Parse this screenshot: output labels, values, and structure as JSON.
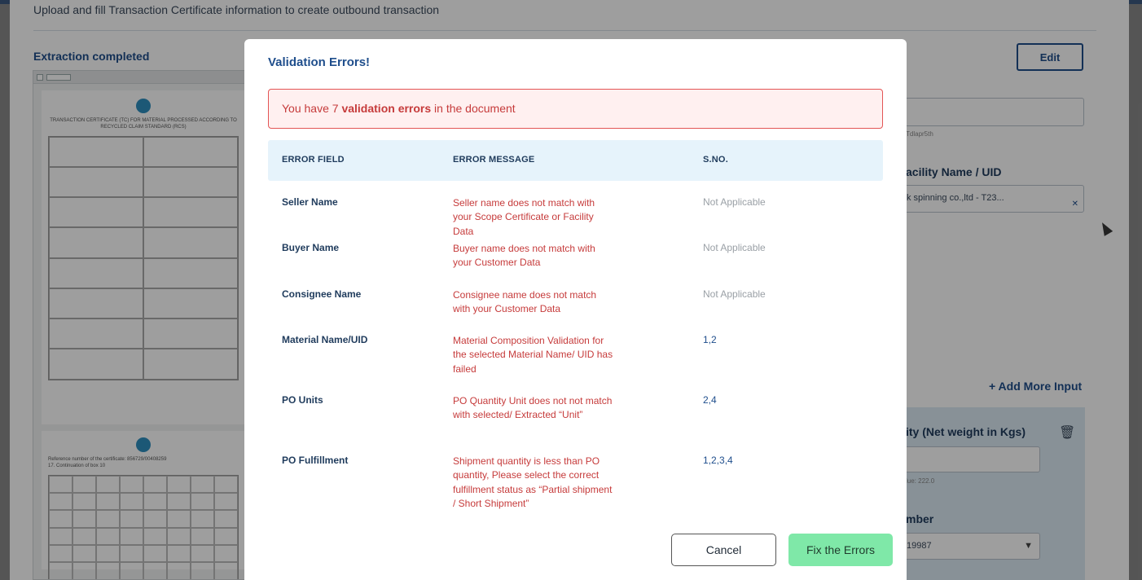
{
  "page": {
    "subtitle": "Upload and fill Transaction Certificate information to create outbound transaction",
    "extraction_status": "Extraction completed",
    "edit_label": "Edit",
    "hint_top": "Tdlapr5th",
    "facility_label": "acility Name / UID",
    "facility_value": "k spinning co.,ltd - T23...",
    "add_more_label": "Add More Input",
    "quantity_label": "ity (Net weight in Kgs)",
    "quantity_hint": "lue: 222.0",
    "number_label": "mber",
    "number_value": "19987",
    "document": {
      "title": "TRANSACTION CERTIFICATE (TC) FOR MATERIAL PROCESSED ACCORDING TO RECYCLED CLAIM STANDARD (RCS)",
      "page2_ref": "Reference number of the certificate:  856729/00408259",
      "page2_section": "17. Continuation of box 10"
    }
  },
  "modal": {
    "title": "Validation Errors!",
    "alert": {
      "prefix": "You have 7 ",
      "emphasis": "validation errors",
      "suffix": " in the document"
    },
    "columns": {
      "field": "ERROR FIELD",
      "message": "ERROR MESSAGE",
      "sno": "S.NO."
    },
    "errors": [
      {
        "field": "Seller Name",
        "message": "Seller name does not match with your Scope Certificate or Facility Data",
        "sno": "Not Applicable",
        "sno_na": true
      },
      {
        "field": "Buyer Name",
        "message": "Buyer name does not match with your Customer Data",
        "sno": "Not Applicable",
        "sno_na": true
      },
      {
        "field": "Consignee Name",
        "message": "Consignee name does not match with your Customer Data",
        "sno": "Not Applicable",
        "sno_na": true
      },
      {
        "field": "Material Name/UID",
        "message": "Material Composition Validation for the selected Material Name/ UID has failed",
        "sno": "1,2",
        "sno_na": false
      },
      {
        "field": "PO Units",
        "message": "PO Quantity Unit does not not match with selected/ Extracted  “Unit”",
        "sno": "2,4",
        "sno_na": false
      },
      {
        "field": "PO Fulfillment",
        "message": "Shipment quantity is less than PO quantity, Please select the correct fulfillment status as “Partial shipment / Short Shipment”",
        "sno": "1,2,3,4",
        "sno_na": false
      }
    ],
    "cancel_label": "Cancel",
    "fix_label": "Fix the Errors"
  }
}
